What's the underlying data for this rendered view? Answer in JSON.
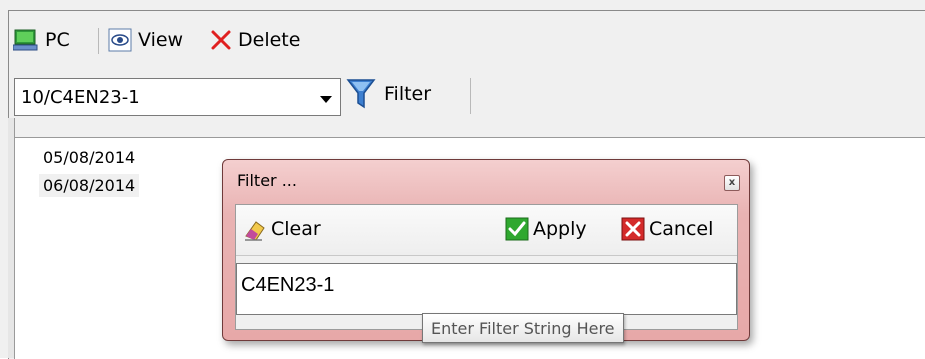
{
  "toolbar": {
    "pc_label": "PC",
    "view_label": "View",
    "delete_label": "Delete"
  },
  "filter_bar": {
    "combo_value": "10/C4EN23-1",
    "filter_label": "Filter"
  },
  "list": {
    "items": [
      "05/08/2014",
      "06/08/2014"
    ],
    "selected_index": 1
  },
  "dialog": {
    "title": "Filter ...",
    "close_label": "x",
    "clear_label": "Clear",
    "apply_label": "Apply",
    "cancel_label": "Cancel",
    "input_value": "C4EN23-1",
    "tooltip": "Enter Filter String Here"
  },
  "colors": {
    "dialog_frame": "#e7a8a8",
    "delete_red": "#e02020",
    "apply_green": "#2fa82f",
    "cancel_red": "#d42a2a"
  }
}
